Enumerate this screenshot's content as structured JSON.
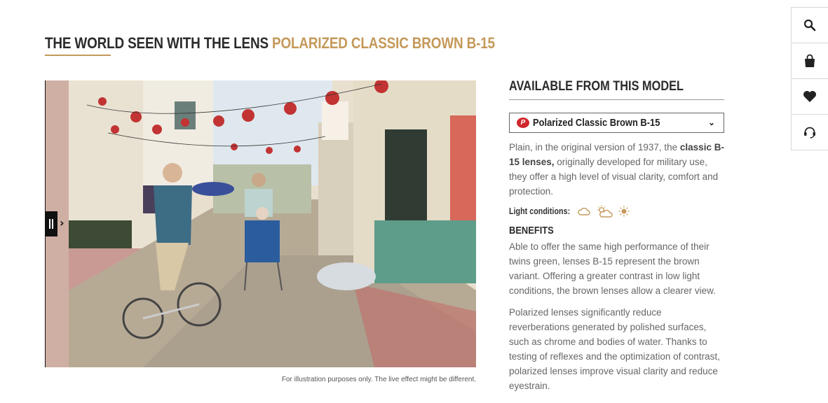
{
  "header": {
    "title_prefix": "THE WORLD SEEN WITH THE LENS",
    "title_accent": "POLARIZED CLASSIC BROWN B-15",
    "accent_color": "#c4995a"
  },
  "viewer": {
    "disclaimer": "For illustration purposes only. The live effect might be different.",
    "handle_arrow": "›"
  },
  "side": {
    "heading": "AVAILABLE FROM THIS MODEL",
    "select": {
      "badge": "P",
      "value": "Polarized Classic Brown B-15",
      "chevron": "⌄"
    },
    "description": {
      "pre": "Plain, in the original version of 1937, the ",
      "bold": "classic B-15 lenses,",
      "post": " originally developed for military use, they offer a high level of visual clarity, comfort and protection."
    },
    "light_label": "Light conditions:",
    "light_icons": [
      "cloud-icon",
      "partly-sunny-icon",
      "sun-icon"
    ],
    "benefits_heading": "BENEFITS",
    "benefits_text": "Able to offer the same high performance of their twins green, lenses B-15 represent the brown variant. Offering a greater contrast in low light conditions, the brown lenses allow a clearer view.",
    "polarized_text": "Polarized lenses significantly reduce reverberations generated by polished surfaces, such as chrome and bodies of water. Thanks to testing of reflexes and the optimization of contrast, polarized lenses improve visual clarity and reduce eyestrain."
  },
  "toolbar": {
    "items": [
      "search-icon",
      "shopping-bag-icon",
      "heart-icon",
      "support-icon"
    ]
  }
}
